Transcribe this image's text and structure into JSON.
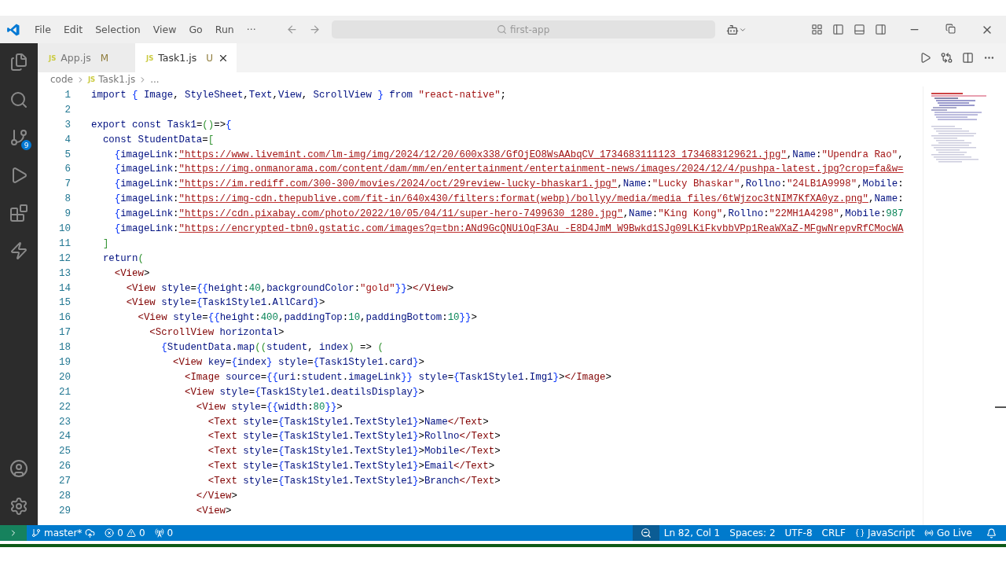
{
  "title_bar": {
    "menu": [
      "File",
      "Edit",
      "Selection",
      "View",
      "Go",
      "Run",
      "···"
    ],
    "search": "first-app"
  },
  "activity_bar": {
    "source_control_badge": "9"
  },
  "tabs": [
    {
      "icon_text": "JS",
      "label": "App.js",
      "badge": "M",
      "selected": false
    },
    {
      "icon_text": "JS",
      "label": "Task1.js",
      "badge": "U",
      "selected": true
    }
  ],
  "breadcrumb": [
    {
      "label": "code"
    },
    {
      "icon_text": "JS",
      "label": "Task1.js"
    },
    {
      "label": "..."
    }
  ],
  "code_lines": [
    {
      "number": "1",
      "text": "import { Image, StyleSheet,Text,View, ScrollView } from \"react-native\";"
    },
    {
      "number": "2"
    },
    {
      "number": "3",
      "text": "export const Task1=()=>{"
    },
    {
      "number": "4",
      "text": "  const StudentData=["
    },
    {
      "number": "5",
      "text": "    {imageLink:\"https://www.livemint.com/lm-img/img/2024/12/20/600x338/GfOjEO8WsAAbqCV_1734683111123_1734683129621.jpg\",Name:\"Upendra Rao\","
    },
    {
      "number": "6",
      "text": "    {imageLink:\"https://img.onmanorama.com/content/dam/mm/en/entertainment/entertainment-news/images/2024/12/4/pushpa-latest.jpg?crop=fa&w="
    },
    {
      "number": "7",
      "text": "    {imageLink:\"https://im.rediff.com/300-300/movies/2024/oct/29review-lucky-bhaskar1.jpg\",Name:\"Lucky Bhaskar\",Rollno:\"24LB1A9998\",Mobile:"
    },
    {
      "number": "8",
      "text": "    {imageLink:\"https://img-cdn.thepublive.com/fit-in/640x430/filters:format(webp)/bollyy/media/media_files/6tWjzoc3tNIM7KfXA0yz.png\",Name:"
    },
    {
      "number": "9",
      "text": "    {imageLink:\"https://cdn.pixabay.com/photo/2022/10/05/04/11/super-hero-7499630_1280.jpg\",Name:\"King Kong\",Rollno:\"22MH1A4298\",Mobile:987"
    },
    {
      "number": "10",
      "text": "    {imageLink:\"https://encrypted-tbn0.gstatic.com/images?q=tbn:ANd9GcQNUiOqF3Au_-E8D4JmM_W9Bwkd1SJg09LKiFkvbbVPp1ReaWXaZ-MFgwNrepvRfCMocWA"
    },
    {
      "number": "11",
      "text": "  ]"
    },
    {
      "number": "12",
      "text": "  return("
    },
    {
      "number": "13",
      "text": "    <View>"
    },
    {
      "number": "14",
      "text": "      <View style={{height:40,backgroundColor:\"gold\"}}></View>"
    },
    {
      "number": "15",
      "text": "      <View style={Task1Style1.AllCard}>"
    },
    {
      "number": "16",
      "text": "        <View style={{height:400,paddingTop:10,paddingBottom:10}}>"
    },
    {
      "number": "17",
      "text": "          <ScrollView horizontal>"
    },
    {
      "number": "18",
      "text": "            {StudentData.map((student, index) => ("
    },
    {
      "number": "19",
      "text": "              <View key={index} style={Task1Style1.card}>"
    },
    {
      "number": "20",
      "text": "                <Image source={{uri:student.imageLink}} style={Task1Style1.Img1}></Image>"
    },
    {
      "number": "21",
      "text": "                <View style={Task1Style1.deatilsDisplay}>"
    },
    {
      "number": "22",
      "text": "                  <View style={{width:80}}>"
    },
    {
      "number": "23",
      "text": "                    <Text style={Task1Style1.TextStyle1}>Name</Text>"
    },
    {
      "number": "24",
      "text": "                    <Text style={Task1Style1.TextStyle1}>Rollno</Text>"
    },
    {
      "number": "25",
      "text": "                    <Text style={Task1Style1.TextStyle1}>Mobile</Text>"
    },
    {
      "number": "26",
      "text": "                    <Text style={Task1Style1.TextStyle1}>Email</Text>"
    },
    {
      "number": "27",
      "text": "                    <Text style={Task1Style1.TextStyle1}>Branch</Text>"
    },
    {
      "number": "28",
      "text": "                  </View>"
    },
    {
      "number": "29",
      "text": "                  <View>"
    }
  ],
  "status_bar": {
    "branch": "master*",
    "errors": "0",
    "warnings": "0",
    "ports": "0",
    "right": [
      {
        "kind": "zoom"
      },
      {
        "kind": "text",
        "label": "Ln 82, Col 1"
      },
      {
        "kind": "text",
        "label": "Spaces: 2"
      },
      {
        "kind": "text",
        "label": "UTF-8"
      },
      {
        "kind": "text",
        "label": "CRLF"
      },
      {
        "kind": "braces",
        "label": "JavaScript"
      },
      {
        "kind": "live",
        "label": "Go Live"
      },
      {
        "kind": "bell"
      }
    ]
  }
}
